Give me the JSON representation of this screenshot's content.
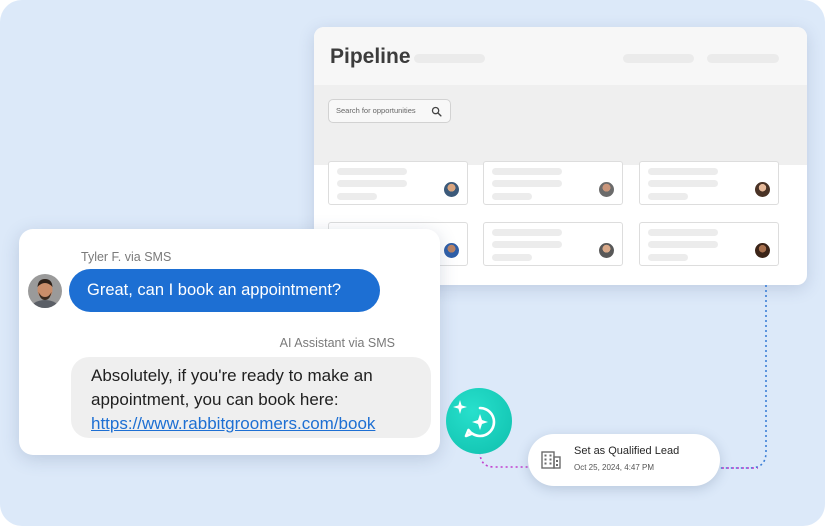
{
  "pipeline": {
    "title": "Pipeline",
    "search_placeholder": "Search for opportunities"
  },
  "chat": {
    "user_sender": "Tyler F. via SMS",
    "user_message": "Great, can I book an appointment?",
    "ai_sender": "AI Assistant via SMS",
    "ai_message_line1": "Absolutely, if you're ready to make an",
    "ai_message_line2": "appointment, you can book here:",
    "ai_link": "https://www.rabbitgroomers.com/book"
  },
  "notification": {
    "title": "Set as Qualified Lead",
    "timestamp": "Oct 25, 2024, 4:47 PM"
  },
  "colors": {
    "background": "#dce9f9",
    "accent_blue": "#1d6fd3",
    "ai_teal": "#1ccfbc",
    "connector_blue": "#3c7fd6",
    "connector_magenta": "#c23fcf"
  },
  "icons": [
    "search-icon",
    "ai-sparkle-chat-icon",
    "building-icon"
  ]
}
